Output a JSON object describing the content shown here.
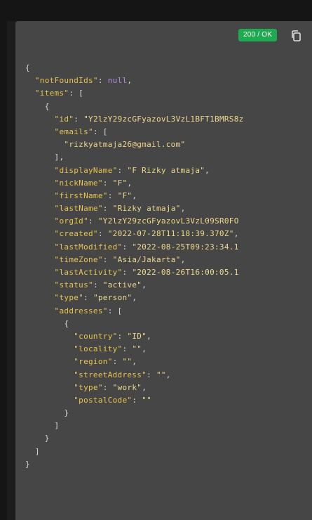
{
  "status_badge": "200 / OK",
  "icons": {
    "copy": "copy-icon"
  },
  "colors": {
    "panel_bg": "#464646",
    "key": "#e6c44f",
    "string": "#f0d98a",
    "null": "#b88ad8",
    "punctuation": "#d8d8d8",
    "badge": "#1faa52"
  },
  "json_lines": [
    [
      {
        "t": "p",
        "v": "{"
      }
    ],
    [
      {
        "t": "p",
        "v": "  "
      },
      {
        "t": "k",
        "v": "\"notFoundIds\""
      },
      {
        "t": "p",
        "v": ": "
      },
      {
        "t": "n",
        "v": "null"
      },
      {
        "t": "p",
        "v": ","
      }
    ],
    [
      {
        "t": "p",
        "v": "  "
      },
      {
        "t": "k",
        "v": "\"items\""
      },
      {
        "t": "p",
        "v": ": ["
      }
    ],
    [
      {
        "t": "p",
        "v": "    {"
      }
    ],
    [
      {
        "t": "p",
        "v": "      "
      },
      {
        "t": "k",
        "v": "\"id\""
      },
      {
        "t": "p",
        "v": ": "
      },
      {
        "t": "s",
        "v": "\"Y2lzY29zcGFyazovL3VzL1BFT1BMRS8z"
      }
    ],
    [
      {
        "t": "p",
        "v": "      "
      },
      {
        "t": "k",
        "v": "\"emails\""
      },
      {
        "t": "p",
        "v": ": ["
      }
    ],
    [
      {
        "t": "p",
        "v": "        "
      },
      {
        "t": "s",
        "v": "\"rizkyatmaja26@gmail.com\""
      }
    ],
    [
      {
        "t": "p",
        "v": "      ],"
      }
    ],
    [
      {
        "t": "p",
        "v": "      "
      },
      {
        "t": "k",
        "v": "\"displayName\""
      },
      {
        "t": "p",
        "v": ": "
      },
      {
        "t": "s",
        "v": "\"F Rizky atmaja\""
      },
      {
        "t": "p",
        "v": ","
      }
    ],
    [
      {
        "t": "p",
        "v": "      "
      },
      {
        "t": "k",
        "v": "\"nickName\""
      },
      {
        "t": "p",
        "v": ": "
      },
      {
        "t": "s",
        "v": "\"F\""
      },
      {
        "t": "p",
        "v": ","
      }
    ],
    [
      {
        "t": "p",
        "v": "      "
      },
      {
        "t": "k",
        "v": "\"firstName\""
      },
      {
        "t": "p",
        "v": ": "
      },
      {
        "t": "s",
        "v": "\"F\""
      },
      {
        "t": "p",
        "v": ","
      }
    ],
    [
      {
        "t": "p",
        "v": "      "
      },
      {
        "t": "k",
        "v": "\"lastName\""
      },
      {
        "t": "p",
        "v": ": "
      },
      {
        "t": "s",
        "v": "\"Rizky atmaja\""
      },
      {
        "t": "p",
        "v": ","
      }
    ],
    [
      {
        "t": "p",
        "v": "      "
      },
      {
        "t": "k",
        "v": "\"orgId\""
      },
      {
        "t": "p",
        "v": ": "
      },
      {
        "t": "s",
        "v": "\"Y2lzY29zcGFyazovL3VzL09SR0FO"
      }
    ],
    [
      {
        "t": "p",
        "v": "      "
      },
      {
        "t": "k",
        "v": "\"created\""
      },
      {
        "t": "p",
        "v": ": "
      },
      {
        "t": "s",
        "v": "\"2022-07-28T11:18:39.370Z\""
      },
      {
        "t": "p",
        "v": ","
      }
    ],
    [
      {
        "t": "p",
        "v": "      "
      },
      {
        "t": "k",
        "v": "\"lastModified\""
      },
      {
        "t": "p",
        "v": ": "
      },
      {
        "t": "s",
        "v": "\"2022-08-25T09:23:34.1"
      }
    ],
    [
      {
        "t": "p",
        "v": "      "
      },
      {
        "t": "k",
        "v": "\"timeZone\""
      },
      {
        "t": "p",
        "v": ": "
      },
      {
        "t": "s",
        "v": "\"Asia/Jakarta\""
      },
      {
        "t": "p",
        "v": ","
      }
    ],
    [
      {
        "t": "p",
        "v": "      "
      },
      {
        "t": "k",
        "v": "\"lastActivity\""
      },
      {
        "t": "p",
        "v": ": "
      },
      {
        "t": "s",
        "v": "\"2022-08-26T16:00:05.1"
      }
    ],
    [
      {
        "t": "p",
        "v": "      "
      },
      {
        "t": "k",
        "v": "\"status\""
      },
      {
        "t": "p",
        "v": ": "
      },
      {
        "t": "s",
        "v": "\"active\""
      },
      {
        "t": "p",
        "v": ","
      }
    ],
    [
      {
        "t": "p",
        "v": "      "
      },
      {
        "t": "k",
        "v": "\"type\""
      },
      {
        "t": "p",
        "v": ": "
      },
      {
        "t": "s",
        "v": "\"person\""
      },
      {
        "t": "p",
        "v": ","
      }
    ],
    [
      {
        "t": "p",
        "v": "      "
      },
      {
        "t": "k",
        "v": "\"addresses\""
      },
      {
        "t": "p",
        "v": ": ["
      }
    ],
    [
      {
        "t": "p",
        "v": "        {"
      }
    ],
    [
      {
        "t": "p",
        "v": "          "
      },
      {
        "t": "k",
        "v": "\"country\""
      },
      {
        "t": "p",
        "v": ": "
      },
      {
        "t": "s",
        "v": "\"ID\""
      },
      {
        "t": "p",
        "v": ","
      }
    ],
    [
      {
        "t": "p",
        "v": "          "
      },
      {
        "t": "k",
        "v": "\"locality\""
      },
      {
        "t": "p",
        "v": ": "
      },
      {
        "t": "s",
        "v": "\"\""
      },
      {
        "t": "p",
        "v": ","
      }
    ],
    [
      {
        "t": "p",
        "v": "          "
      },
      {
        "t": "k",
        "v": "\"region\""
      },
      {
        "t": "p",
        "v": ": "
      },
      {
        "t": "s",
        "v": "\"\""
      },
      {
        "t": "p",
        "v": ","
      }
    ],
    [
      {
        "t": "p",
        "v": "          "
      },
      {
        "t": "k",
        "v": "\"streetAddress\""
      },
      {
        "t": "p",
        "v": ": "
      },
      {
        "t": "s",
        "v": "\"\""
      },
      {
        "t": "p",
        "v": ","
      }
    ],
    [
      {
        "t": "p",
        "v": "          "
      },
      {
        "t": "k",
        "v": "\"type\""
      },
      {
        "t": "p",
        "v": ": "
      },
      {
        "t": "s",
        "v": "\"work\""
      },
      {
        "t": "p",
        "v": ","
      }
    ],
    [
      {
        "t": "p",
        "v": "          "
      },
      {
        "t": "k",
        "v": "\"postalCode\""
      },
      {
        "t": "p",
        "v": ": "
      },
      {
        "t": "s",
        "v": "\"\""
      }
    ],
    [
      {
        "t": "p",
        "v": "        }"
      }
    ],
    [
      {
        "t": "p",
        "v": "      ]"
      }
    ],
    [
      {
        "t": "p",
        "v": "    }"
      }
    ],
    [
      {
        "t": "p",
        "v": "  ]"
      }
    ],
    [
      {
        "t": "p",
        "v": "}"
      }
    ]
  ]
}
